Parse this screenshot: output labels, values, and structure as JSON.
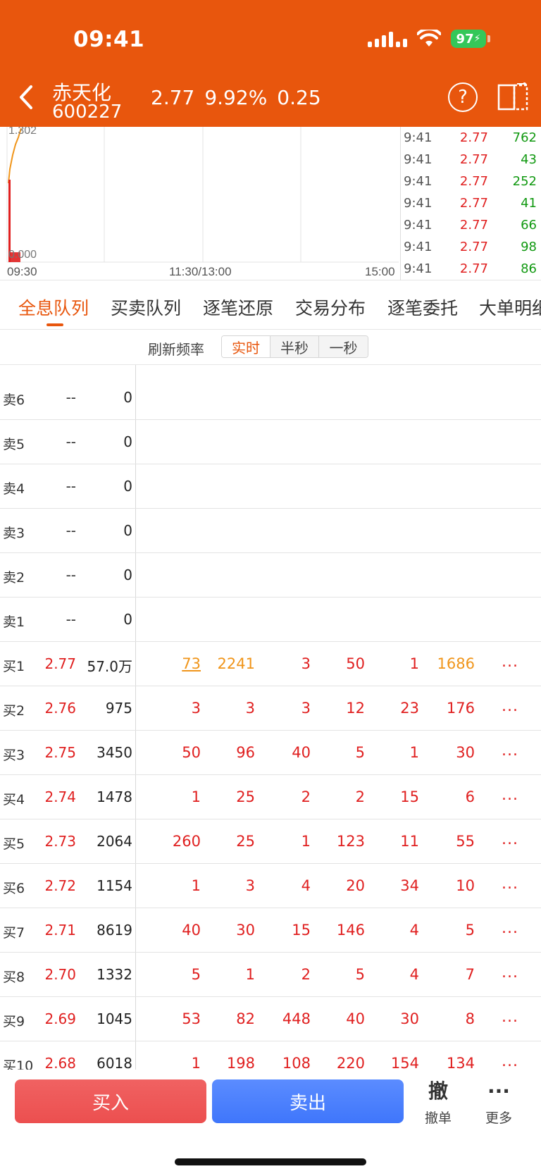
{
  "status": {
    "time": "09:41",
    "battery": "97"
  },
  "header": {
    "name": "赤天化",
    "code": "600227",
    "price": "2.77",
    "change_pct": "9.92%",
    "change": "0.25",
    "help": "?"
  },
  "chart": {
    "y_top": "1.302",
    "y_bottom": "0.000",
    "x_labels": [
      "09:30",
      "11:30/13:00",
      "15:00"
    ]
  },
  "ticks": [
    {
      "time": "9:41",
      "price": "2.77",
      "vol": "762"
    },
    {
      "time": "9:41",
      "price": "2.77",
      "vol": "43"
    },
    {
      "time": "9:41",
      "price": "2.77",
      "vol": "252"
    },
    {
      "time": "9:41",
      "price": "2.77",
      "vol": "41"
    },
    {
      "time": "9:41",
      "price": "2.77",
      "vol": "66"
    },
    {
      "time": "9:41",
      "price": "2.77",
      "vol": "98"
    },
    {
      "time": "9:41",
      "price": "2.77",
      "vol": "86"
    }
  ],
  "tabs": [
    {
      "label": "全息队列",
      "active": true
    },
    {
      "label": "买卖队列"
    },
    {
      "label": "逐笔还原"
    },
    {
      "label": "交易分布"
    },
    {
      "label": "逐笔委托"
    },
    {
      "label": "大单明细"
    }
  ],
  "refresh": {
    "label": "刷新频率",
    "options": [
      "实时",
      "半秒",
      "一秒"
    ],
    "active": "实时"
  },
  "sell_levels": [
    {
      "label": "卖6",
      "price": "--",
      "vol": "0"
    },
    {
      "label": "卖5",
      "price": "--",
      "vol": "0"
    },
    {
      "label": "卖4",
      "price": "--",
      "vol": "0"
    },
    {
      "label": "卖3",
      "price": "--",
      "vol": "0"
    },
    {
      "label": "卖2",
      "price": "--",
      "vol": "0"
    },
    {
      "label": "卖1",
      "price": "--",
      "vol": "0"
    }
  ],
  "buy_levels": [
    {
      "label": "买1",
      "price": "2.77",
      "vol": "57.0万",
      "orders": [
        "73",
        "2241",
        "3",
        "50",
        "1",
        "1686"
      ],
      "orange": [
        0,
        1,
        5
      ],
      "underline": [
        0
      ]
    },
    {
      "label": "买2",
      "price": "2.76",
      "vol": "975",
      "orders": [
        "3",
        "3",
        "3",
        "12",
        "23",
        "176"
      ]
    },
    {
      "label": "买3",
      "price": "2.75",
      "vol": "3450",
      "orders": [
        "50",
        "96",
        "40",
        "5",
        "1",
        "30"
      ]
    },
    {
      "label": "买4",
      "price": "2.74",
      "vol": "1478",
      "orders": [
        "1",
        "25",
        "2",
        "2",
        "15",
        "6"
      ]
    },
    {
      "label": "买5",
      "price": "2.73",
      "vol": "2064",
      "orders": [
        "260",
        "25",
        "1",
        "123",
        "11",
        "55"
      ]
    },
    {
      "label": "买6",
      "price": "2.72",
      "vol": "1154",
      "orders": [
        "1",
        "3",
        "4",
        "20",
        "34",
        "10"
      ]
    },
    {
      "label": "买7",
      "price": "2.71",
      "vol": "8619",
      "orders": [
        "40",
        "30",
        "15",
        "146",
        "4",
        "5"
      ]
    },
    {
      "label": "买8",
      "price": "2.70",
      "vol": "1332",
      "orders": [
        "5",
        "1",
        "2",
        "5",
        "4",
        "7"
      ]
    },
    {
      "label": "买9",
      "price": "2.69",
      "vol": "1045",
      "orders": [
        "53",
        "82",
        "448",
        "40",
        "30",
        "8"
      ]
    },
    {
      "label": "买10",
      "price": "2.68",
      "vol": "6018",
      "orders": [
        "1",
        "198",
        "108",
        "220",
        "154",
        "134"
      ]
    }
  ],
  "more_dots": "...",
  "bottom": {
    "buy": "买入",
    "sell": "卖出",
    "cancel_icon": "撤",
    "cancel": "撤单",
    "more_icon": "···",
    "more": "更多"
  }
}
